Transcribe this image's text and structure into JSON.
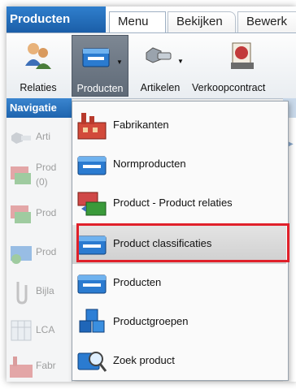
{
  "app_tab": "Producten",
  "ribbon_tabs": [
    "Menu",
    "Bekijken",
    "Bewerk"
  ],
  "toolbar": {
    "buttons": [
      "Relaties",
      "Producten",
      "Artikelen",
      "Verkoopcontract"
    ]
  },
  "nav": {
    "header": "Navigatie",
    "items": [
      "Arti",
      "Prod",
      "(0)",
      "Prod",
      "Prod",
      "Bijla",
      "LCA",
      "Fabr"
    ]
  },
  "menu": {
    "items": [
      "Fabrikanten",
      "Normproducten",
      "Product - Product relaties",
      "Product classificaties",
      "Producten",
      "Productgroepen",
      "Zoek product"
    ],
    "highlighted": "Product classificaties"
  },
  "colors": {
    "accent_blue": "#1b5ea8",
    "highlight_border": "#e0202a"
  }
}
